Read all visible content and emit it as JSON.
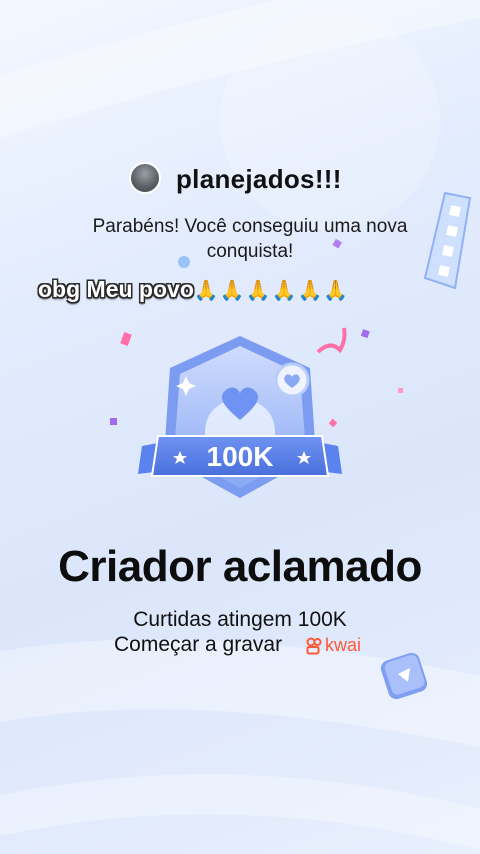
{
  "header": {
    "username": "planejados!!!"
  },
  "achievement": {
    "subtitle_line1": "Parabéns! Você conseguiu uma nova",
    "subtitle_line2": "conquista!",
    "badge_label": "100K",
    "title": "Criador aclamado",
    "description": "Curtidas atingem 100K",
    "cta": "Começar a gravar",
    "brand": "kwai"
  },
  "overlay": {
    "text": "obg Meu povo",
    "emoji": "🙏🙏🙏🙏🙏🙏"
  },
  "colors": {
    "badge_primary": "#5b82ee",
    "badge_light": "#b9cdfb",
    "kwai_orange": "#ff5a36",
    "confetti_pink": "#ff6fa8",
    "confetti_purple": "#a06bf0"
  },
  "icons": [
    "heart-icon",
    "sparkle-icon",
    "star-icon",
    "film-strip-icon",
    "play-icon",
    "kwai-logo-icon"
  ]
}
